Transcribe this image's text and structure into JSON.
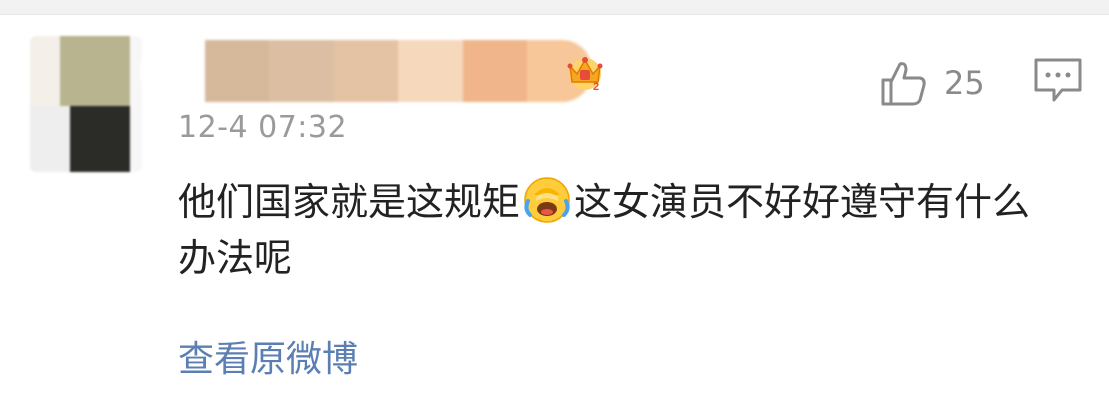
{
  "comment": {
    "timestamp": "12-4 07:32",
    "text_part1": "他们国家就是这规矩",
    "emoji": "laughing-crying-emoji",
    "text_part2": "这女演员不好好遵守有什么办法呢",
    "like_count": "25",
    "view_link": "查看原微博"
  },
  "icons": {
    "like": "thumbs-up-icon",
    "reply": "comment-bubble-icon",
    "badge": "vip-crown-icon"
  },
  "colors": {
    "link": "#5b7fb3",
    "text": "#222222",
    "meta": "#9a9a9a",
    "mosaic": [
      "#ead8c6",
      "#d6b89a",
      "#dcbfa2",
      "#e4c2a4",
      "#f6d8bd",
      "#f0b58a",
      "#f7c79a"
    ]
  }
}
